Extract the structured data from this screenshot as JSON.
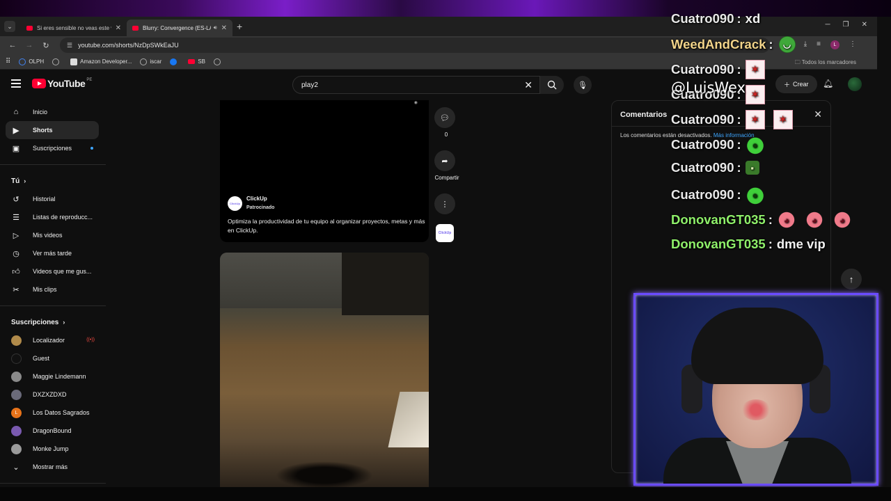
{
  "browser": {
    "tabs": [
      {
        "title": "Si eres sensible no veas este vi",
        "active": false
      },
      {
        "title": "Blurry: Convergence (ES-LA",
        "active": true
      }
    ],
    "url": "youtube.com/shorts/NzDpSWkEaJU",
    "bookmarks": [
      "OLPH",
      "",
      "Amazon Developer...",
      "iscar",
      "",
      "SB",
      ""
    ],
    "bookmarks_all": "Todos los marcadores"
  },
  "youtube": {
    "logo_text": "YouTube",
    "country": "PE",
    "search_value": "play2",
    "create_label": "Crear"
  },
  "sidebar": {
    "main": [
      {
        "label": "Inicio",
        "icon": "home-icon"
      },
      {
        "label": "Shorts",
        "icon": "shorts-icon"
      },
      {
        "label": "Suscripciones",
        "icon": "subscriptions-icon"
      }
    ],
    "you_header": "Tú",
    "you": [
      {
        "label": "Historial",
        "icon": "history-icon"
      },
      {
        "label": "Listas de reproducc...",
        "icon": "playlists-icon"
      },
      {
        "label": "Mis videos",
        "icon": "my-videos-icon"
      },
      {
        "label": "Ver más tarde",
        "icon": "watch-later-icon"
      },
      {
        "label": "Videos que me gus...",
        "icon": "like-icon"
      },
      {
        "label": "Mis clips",
        "icon": "clips-icon"
      }
    ],
    "subs_header": "Suscripciones",
    "subs": [
      {
        "label": "Localizador",
        "color": "#b08a4a"
      },
      {
        "label": "Guest",
        "color": "#111111"
      },
      {
        "label": "Maggie Lindemann",
        "color": "#8a8a8a"
      },
      {
        "label": "DXZXZDXD",
        "color": "#6a6a7a"
      },
      {
        "label": "Los Datos Sagrados",
        "color": "#e8731a"
      },
      {
        "label": "DragonBound",
        "color": "#7a5ab0"
      },
      {
        "label": "Monke Jump",
        "color": "#9a9a9a"
      }
    ],
    "show_more": "Mostrar más"
  },
  "ad": {
    "channel": "ClickUp",
    "sponsored": "Patrocinado",
    "description": "Optimiza la productividad de tu equipo al organizar proyectos, metas y más en ClickUp."
  },
  "actions": {
    "comments_count": "0",
    "share_label": "Compartir"
  },
  "comments_panel": {
    "title": "Comentarios",
    "disabled_text": "Los comentarios están desactivados.",
    "more_info": "Más información"
  },
  "overlay": {
    "watermark": "@LuisWex",
    "chat": [
      {
        "user": "Cuatro090",
        "color": "white",
        "text": "xd",
        "emotes": []
      },
      {
        "user": "WeedAndCrack",
        "color": "gold",
        "text": "",
        "emotes": [
          "green"
        ]
      },
      {
        "user": "Cuatro090",
        "color": "white",
        "text": "",
        "emotes": [
          "rage"
        ]
      },
      {
        "user": "Cuatro090",
        "color": "white",
        "text": "",
        "emotes": [
          "rage"
        ]
      },
      {
        "user": "Cuatro090",
        "color": "white",
        "text": "",
        "emotes": [
          "rage",
          "rage"
        ]
      },
      {
        "user": "Cuatro090",
        "color": "white",
        "text": "",
        "emotes": [
          "frog"
        ]
      },
      {
        "user": "Cuatro090",
        "color": "white",
        "text": "",
        "emotes": [
          "shrek"
        ]
      },
      {
        "user": "Cuatro090",
        "color": "white",
        "text": "",
        "emotes": [
          "frog"
        ]
      },
      {
        "user": "DonovanGT035",
        "color": "green",
        "text": "",
        "emotes": [
          "pink",
          "pink",
          "pink"
        ]
      },
      {
        "user": "DonovanGT035",
        "color": "green",
        "text": "dme vip",
        "emotes": []
      }
    ]
  }
}
